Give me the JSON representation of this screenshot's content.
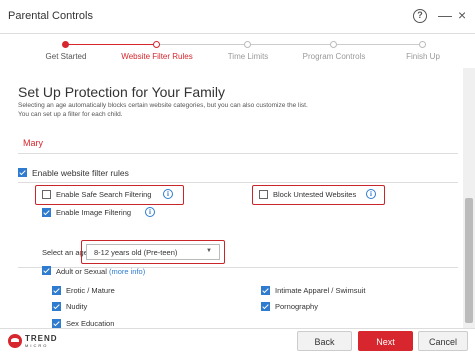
{
  "window": {
    "title": "Parental Controls",
    "help_glyph": "?",
    "minimize_glyph": "—",
    "close_glyph": "×"
  },
  "steps": [
    {
      "label": "Get Started",
      "state": "done"
    },
    {
      "label": "Website Filter Rules",
      "state": "active"
    },
    {
      "label": "Time Limits",
      "state": "todo"
    },
    {
      "label": "Program Controls",
      "state": "todo"
    },
    {
      "label": "Finish Up",
      "state": "todo"
    }
  ],
  "main": {
    "heading": "Set Up Protection for Your Family",
    "description_line1": "Selecting an age automatically blocks certain website categories, but you can also customize the list.",
    "description_line2": "You can set up a filter for each child.",
    "child_name": "Mary",
    "enable_filter": {
      "label": "Enable website filter rules",
      "checked": true
    },
    "safe_search": {
      "label": "Enable Safe Search Filtering",
      "checked": false
    },
    "block_untested": {
      "label": "Block Untested Websites",
      "checked": false
    },
    "image_filtering": {
      "label": "Enable Image Filtering",
      "checked": true
    },
    "age": {
      "label": "Select an age :",
      "value": "8-12 years old (Pre-teen)"
    },
    "category_group": {
      "label": "Adult or Sexual",
      "more_info": "(more info)",
      "checked": true
    },
    "categories": [
      {
        "label": "Erotic / Mature",
        "checked": true
      },
      {
        "label": "Intimate Apparel / Swimsuit",
        "checked": true
      },
      {
        "label": "Nudity",
        "checked": true
      },
      {
        "label": "Pornography",
        "checked": true
      },
      {
        "label": "Sex Education",
        "checked": true
      }
    ]
  },
  "footer": {
    "brand": "TREND",
    "brand_sub": "MICRO",
    "back_label": "Back",
    "next_label": "Next",
    "cancel_label": "Cancel"
  },
  "colors": {
    "accent_red": "#d7262d",
    "link_blue": "#2e7bcf",
    "highlight_box": "#c8262b"
  }
}
